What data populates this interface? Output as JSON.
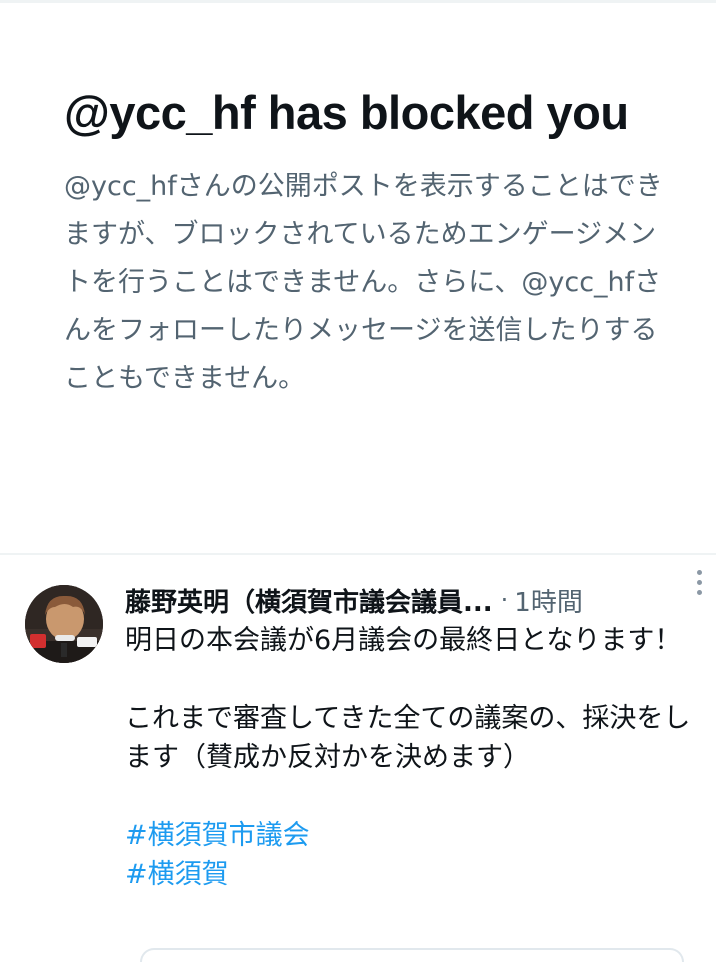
{
  "blocked_notice": {
    "title": "@ycc_hf has blocked you",
    "description": "@ycc_hfさんの公開ポストを表示することはできますが、ブロックされているためエンゲージメントを行うことはできません。さらに、@ycc_hfさんをフォローしたりメッセージを送信したりすることもできません。"
  },
  "post": {
    "author_name": "藤野英明（横須賀市議会議員...",
    "separator": "·",
    "time": "1時間",
    "text_line1": "明日の本会議が6月議会の最終日となります！",
    "text_line2": "これまで審査してきた全ての議案の、採決をします（賛成か反対かを決めます）",
    "hashtags": [
      "#横須賀市議会",
      "#横須賀"
    ],
    "more_icon": "more-vertical-icon"
  },
  "colors": {
    "text_primary": "#0f1419",
    "text_secondary": "#536471",
    "link": "#1d9bf0",
    "divider": "#eff3f4"
  }
}
